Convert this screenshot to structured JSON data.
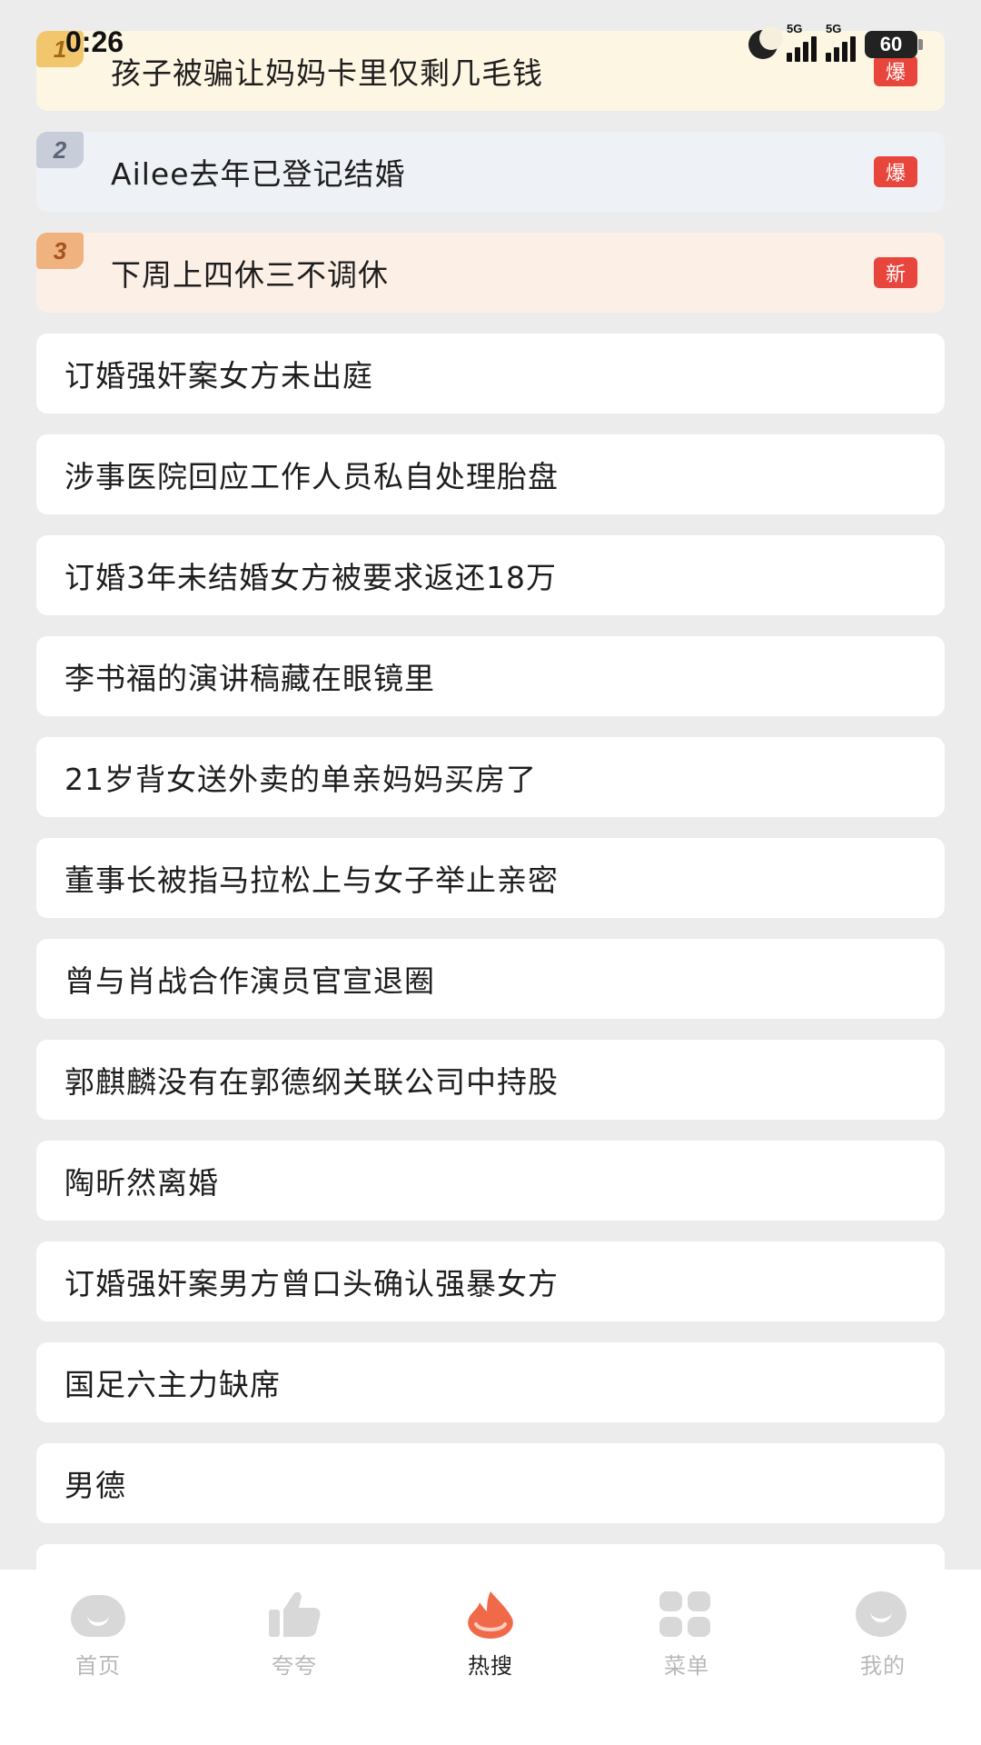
{
  "status_bar": {
    "time": "0:26",
    "network_1": "5G",
    "network_2": "5G",
    "battery": "60"
  },
  "hot_list": [
    {
      "rank": "1",
      "title": "孩子被骗让妈妈卡里仅剩几毛钱",
      "tag": "爆"
    },
    {
      "rank": "2",
      "title": "Ailee去年已登记结婚",
      "tag": "爆"
    },
    {
      "rank": "3",
      "title": "下周上四休三不调休",
      "tag": "新"
    },
    {
      "title": "订婚强奸案女方未出庭"
    },
    {
      "title": "涉事医院回应工作人员私自处理胎盘"
    },
    {
      "title": "订婚3年未结婚女方被要求返还18万"
    },
    {
      "title": "李书福的演讲稿藏在眼镜里"
    },
    {
      "title": "21岁背女送外卖的单亲妈妈买房了"
    },
    {
      "title": "董事长被指马拉松上与女子举止亲密"
    },
    {
      "title": "曾与肖战合作演员官宣退圈"
    },
    {
      "title": "郭麒麟没有在郭德纲关联公司中持股"
    },
    {
      "title": "陶昕然离婚"
    },
    {
      "title": "订婚强奸案男方曾口头确认强暴女方"
    },
    {
      "title": "国足六主力缺席"
    },
    {
      "title": "男德"
    }
  ],
  "bottom_nav": [
    {
      "label": "首页",
      "icon": "home-face-icon"
    },
    {
      "label": "夸夸",
      "icon": "thumbs-up-icon"
    },
    {
      "label": "热搜",
      "icon": "flame-icon",
      "active": true
    },
    {
      "label": "菜单",
      "icon": "grid-menu-icon"
    },
    {
      "label": "我的",
      "icon": "profile-face-icon"
    }
  ],
  "colors": {
    "background": "#ececec",
    "card": "#ffffff",
    "hot_tag": "#e8453c",
    "flame": "#f06a4a",
    "inactive_nav": "#b8b8b8"
  }
}
